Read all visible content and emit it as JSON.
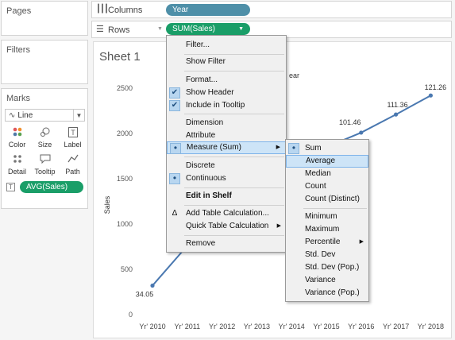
{
  "left_panel": {
    "pages_title": "Pages",
    "filters_title": "Filters",
    "marks_title": "Marks",
    "mark_type": "Line",
    "mark_buttons": [
      {
        "label": "Color",
        "icon": "color-dots-icon"
      },
      {
        "label": "Size",
        "icon": "size-icon"
      },
      {
        "label": "Label",
        "icon": "label-icon"
      },
      {
        "label": "Detail",
        "icon": "detail-icon"
      },
      {
        "label": "Tooltip",
        "icon": "tooltip-icon"
      },
      {
        "label": "Path",
        "icon": "path-icon"
      }
    ],
    "label_pill": "AVG(Sales)"
  },
  "shelves": {
    "columns_label": "Columns",
    "columns_pill": "Year",
    "rows_label": "Rows",
    "rows_pill": "SUM(Sales)"
  },
  "sheet": {
    "title": "Sheet 1",
    "partial_header": "ear"
  },
  "chart_data": {
    "type": "line",
    "categories": [
      "Yr' 2010",
      "Yr' 2011",
      "Yr' 2012",
      "Yr' 2013",
      "Yr' 2014",
      "Yr' 2015",
      "Yr' 2016",
      "Yr' 2017",
      "Yr' 2018"
    ],
    "visible_points": [
      {
        "x": "Yr' 2010",
        "y": 34.05
      },
      {
        "x": "Yr' 2016",
        "y": 101.46
      },
      {
        "x": "Yr' 2017",
        "y": 111.36
      },
      {
        "x": "Yr' 2018",
        "y": 121.26
      }
    ],
    "visible_path_y": [
      {
        "x": "Yr' 2010",
        "y": 320
      },
      {
        "x": "Yr' 2011",
        "y": 760
      },
      {
        "x": "Yr' 2015",
        "y": 1850
      },
      {
        "x": "Yr' 2016",
        "y": 2010
      },
      {
        "x": "Yr' 2017",
        "y": 2210
      },
      {
        "x": "Yr' 2018",
        "y": 2420
      }
    ],
    "data_labels": [
      "34.05",
      "101.46",
      "111.36",
      "121.26"
    ],
    "ylabel": "Sales",
    "yticks": [
      "0",
      "500",
      "1000",
      "1500",
      "2000",
      "2500"
    ],
    "ylim": [
      0,
      2650
    ],
    "color": "#4a78b0"
  },
  "context_menu": {
    "items": [
      {
        "label": "Filter..."
      },
      {
        "label": "Show Filter"
      },
      {
        "label": "Format..."
      },
      {
        "label": "Show Header",
        "checked": true
      },
      {
        "label": "Include in Tooltip",
        "checked": true
      },
      {
        "label": "Dimension"
      },
      {
        "label": "Attribute"
      },
      {
        "label": "Measure (Sum)",
        "bullet": true,
        "submenu": true,
        "highlighted": true
      },
      {
        "label": "Discrete"
      },
      {
        "label": "Continuous",
        "bullet": true
      },
      {
        "label": "Edit in Shelf",
        "bold": true
      },
      {
        "label": "Add Table Calculation...",
        "icon": "delta-icon"
      },
      {
        "label": "Quick Table Calculation",
        "submenu": true
      },
      {
        "label": "Remove"
      }
    ]
  },
  "submenu": {
    "items": [
      {
        "label": "Sum",
        "bullet": true
      },
      {
        "label": "Average",
        "highlighted": true
      },
      {
        "label": "Median"
      },
      {
        "label": "Count"
      },
      {
        "label": "Count (Distinct)"
      },
      {
        "label": "Minimum"
      },
      {
        "label": "Maximum"
      },
      {
        "label": "Percentile",
        "submenu": true
      },
      {
        "label": "Std. Dev"
      },
      {
        "label": "Std. Dev (Pop.)"
      },
      {
        "label": "Variance"
      },
      {
        "label": "Variance (Pop.)"
      }
    ]
  }
}
